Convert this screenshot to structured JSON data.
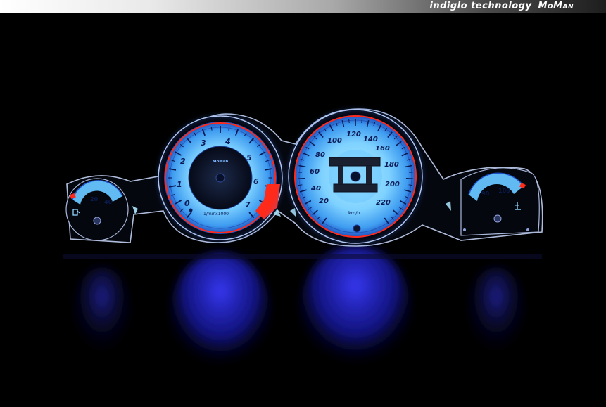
{
  "banner": {
    "tagline": "indiglo technology",
    "logo_text": "MoMan"
  },
  "tachometer": {
    "numbers": [
      "0",
      "1",
      "2",
      "3",
      "4",
      "5",
      "6",
      "7"
    ],
    "brand": "MoMan",
    "unit_label": "1/minx1000"
  },
  "speedometer": {
    "numbers": [
      "20",
      "40",
      "60",
      "80",
      "100",
      "120",
      "140",
      "160",
      "180",
      "200",
      "220"
    ],
    "unit_label": "km/h"
  },
  "fuel_gauge": {
    "numbers": [
      "20",
      "40"
    ]
  },
  "temp_gauge": {
    "numbers": [
      "90",
      "100"
    ]
  },
  "colors": {
    "dial_glow": "#5ab8ff",
    "accent_red": "#ff2a1a",
    "background": "#000000"
  },
  "icons": [
    "fuel-pump-icon",
    "coolant-temperature-icon"
  ]
}
